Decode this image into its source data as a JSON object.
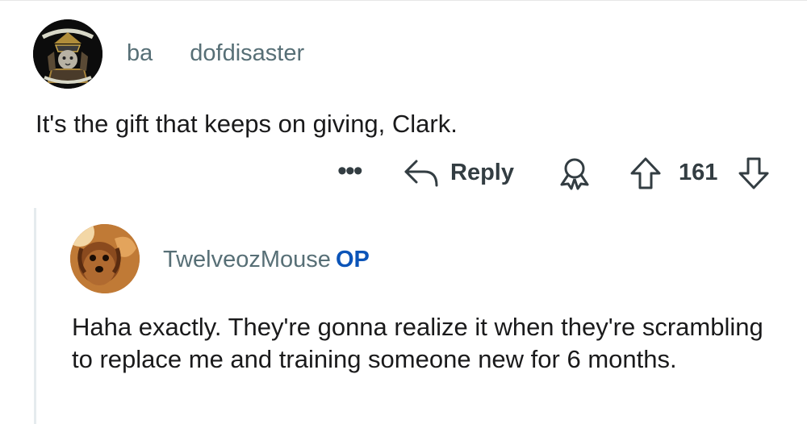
{
  "parent_comment": {
    "username_prefix": "ba",
    "username_suffix": "dofdisaster",
    "avatar_icon": "samurai-cat-avatar",
    "body": "It's the gift that keeps on giving, Clark."
  },
  "actions": {
    "more_label": "•••",
    "reply_label": "Reply",
    "score": "161"
  },
  "reply_comment": {
    "username": "TwelveozMouse",
    "op_badge": "OP",
    "avatar_icon": "dog-avatar",
    "body": "Haha exactly. They're gonna realize it when they're scrambling to replace me and training someone new for 6 months."
  },
  "colors": {
    "meta_text": "#576f76",
    "action_text": "#333d42",
    "op_badge": "#0b54b8",
    "thread_line": "#e5ebee"
  }
}
